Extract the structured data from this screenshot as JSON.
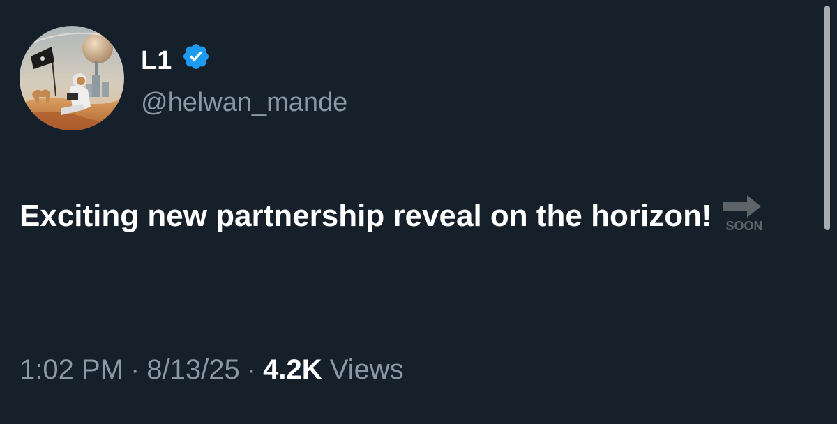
{
  "author": {
    "display_name": "L1",
    "handle": "@helwan_mande",
    "verified": true,
    "verified_color": "#1d9bf0",
    "avatar_icon": "astronaut-desert-avatar"
  },
  "tweet": {
    "text": "Exciting new partnership reveal on the horizon!",
    "emoji_name": "soon-arrow",
    "emoji_text": "SOON"
  },
  "meta": {
    "time": "1:02 PM",
    "separator": "·",
    "date": "8/13/25",
    "views_count": "4.2K",
    "views_label": "Views"
  },
  "colors": {
    "background": "#15202b",
    "primary_text": "#ffffff",
    "secondary_text": "#8b98a5"
  }
}
